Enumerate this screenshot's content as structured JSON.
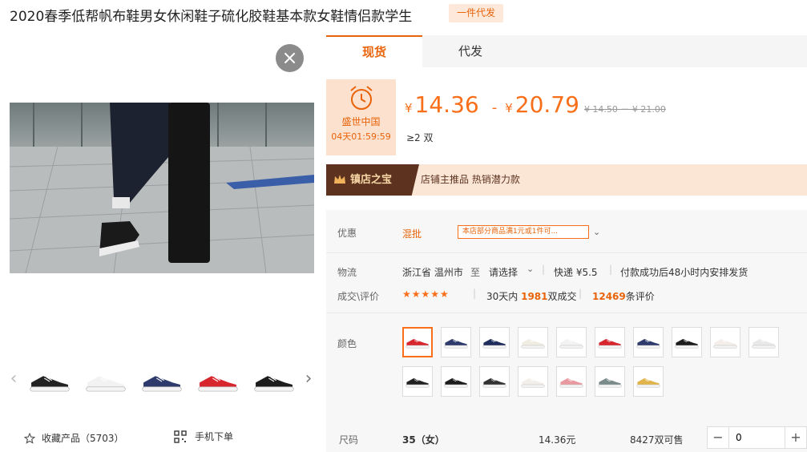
{
  "title": "2020春季低帮帆布鞋男女休闲鞋子硫化胶鞋基本款女鞋情侣款学生",
  "ship_tag": "一件代发",
  "close_symbol": "×",
  "gallery": {
    "prev": "‹",
    "next": "›",
    "favorite": "收藏产品（5703）",
    "mobile_order": "手机下单",
    "thumb_colors": [
      "#222222",
      "#f2f2f2",
      "#2d3a6b",
      "#d8262f",
      "#1c1c1c"
    ]
  },
  "tabs": [
    "现货",
    "代发"
  ],
  "promo": {
    "name": "盛世中国",
    "countdown": "04天01:59:59"
  },
  "price": {
    "currency": "¥",
    "low": "14.36",
    "dash": "-",
    "high": "20.79",
    "original": "¥ 14.50 － ¥ 21.00",
    "min_qty": "≥2 双"
  },
  "banner": {
    "badge": "镇店之宝",
    "text": "店铺主推品   热销潜力款"
  },
  "discount": {
    "label": "优惠",
    "type": "混批",
    "coupon": "本店部分商品满1元或1件可..."
  },
  "logistics": {
    "label": "物流",
    "origin": "浙江省 温州市",
    "to": "至",
    "select": "请选择",
    "express": "快递 ¥5.5",
    "delivery": "付款成功后48小时内安排发货"
  },
  "deals": {
    "label": "成交\\评价",
    "stars": "★★★★★",
    "prefix": "30天内",
    "count": "1981",
    "suffix": "双成交",
    "reviews": "12469",
    "reviews_suffix": "条评价"
  },
  "color": {
    "label": "颜色"
  },
  "size": {
    "label": "尺码",
    "value": "35（女）",
    "price": "14.36元",
    "stock": "8427双可售",
    "qty": "0",
    "minus": "−",
    "plus": "+"
  },
  "colors_hex": {
    "accent": "#f96e18",
    "brown": "#5d3320"
  }
}
